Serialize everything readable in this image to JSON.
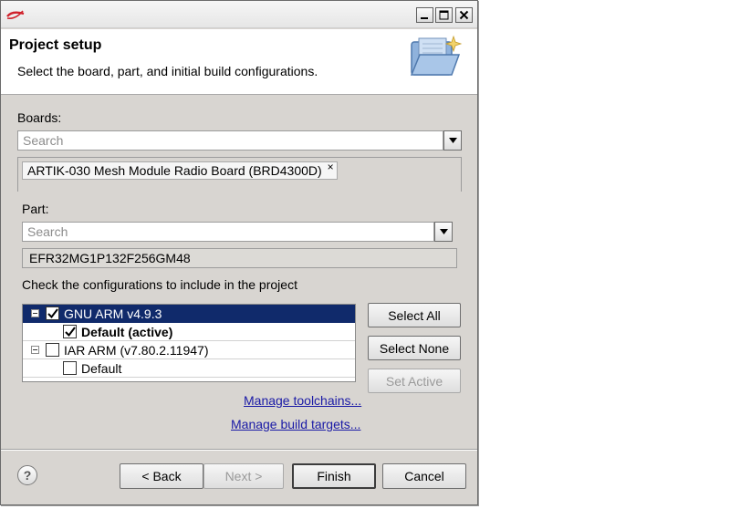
{
  "header": {
    "title": "Project setup",
    "description": "Select the board, part, and initial build configurations."
  },
  "boards": {
    "label": "Boards:",
    "search_placeholder": "Search",
    "selected_chip": "ARTIK-030 Mesh Module Radio Board (BRD4300D)",
    "chip_remove": "×"
  },
  "part": {
    "label": "Part:",
    "search_placeholder": "Search",
    "value": "EFR32MG1P132F256GM48"
  },
  "configs": {
    "label": "Check the configurations to include in the project",
    "tree": [
      {
        "label": "GNU ARM v4.9.3",
        "checked": true,
        "selected": true
      },
      {
        "label": "Default (active)",
        "checked": true
      },
      {
        "label": "IAR ARM (v7.80.2.11947)",
        "checked": false
      },
      {
        "label": "Default",
        "checked": false
      }
    ],
    "select_all": "Select All",
    "select_none": "Select None",
    "set_active": "Set Active"
  },
  "links": {
    "manage_toolchains": "Manage toolchains...",
    "manage_build_targets": "Manage build targets..."
  },
  "footer": {
    "help": "?",
    "back": "< Back",
    "next": "Next >",
    "finish": "Finish",
    "cancel": "Cancel"
  },
  "colors": {
    "dialog_bg": "#d8d5d1",
    "selection": "#102a6b",
    "link": "#1a1aa6"
  }
}
